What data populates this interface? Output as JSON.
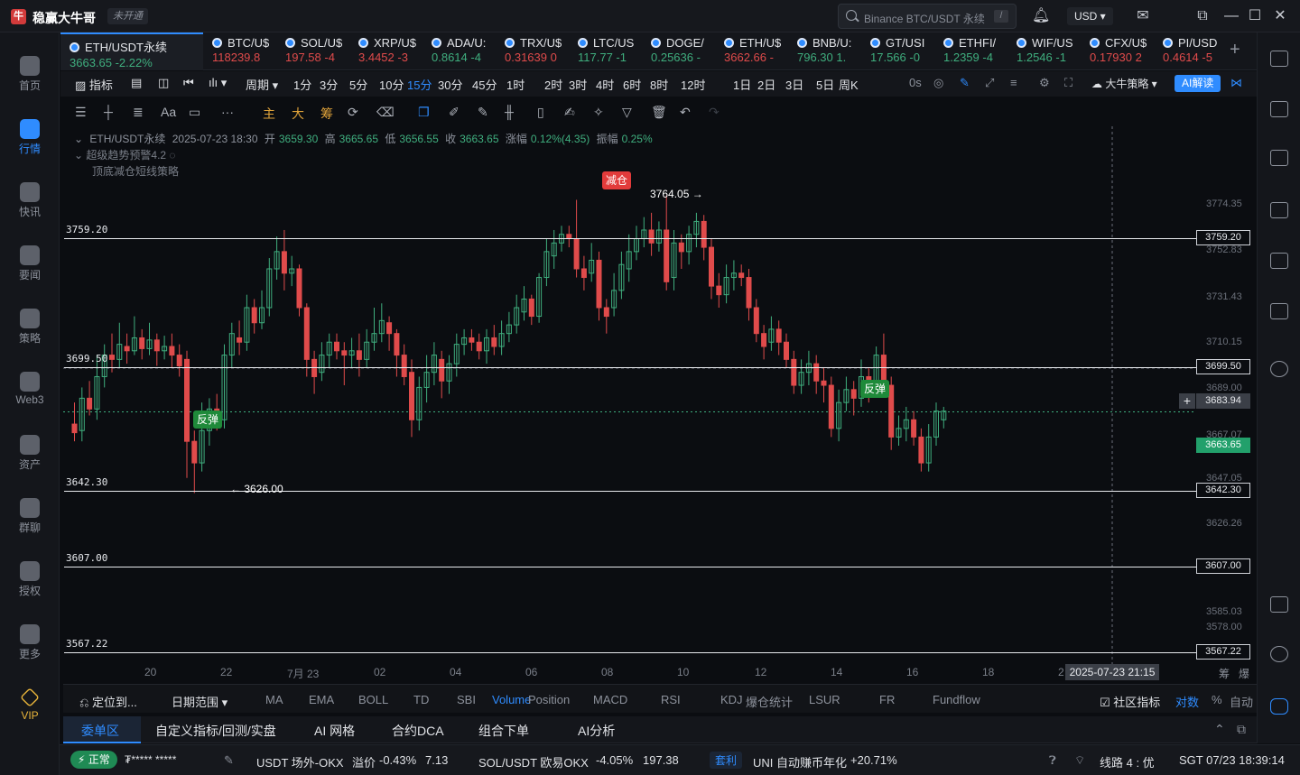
{
  "app": {
    "title": "稳赢大牛哥",
    "logo_text": "牛",
    "account_status": "未开通",
    "search_placeholder": "Binance BTC/USDT 永续",
    "search_shortcut": "/",
    "currency": "USD ▾"
  },
  "leftnav": [
    {
      "label": "首页",
      "active": false
    },
    {
      "label": "行情",
      "active": true
    },
    {
      "label": "快讯",
      "active": false
    },
    {
      "label": "要闻",
      "active": false
    },
    {
      "label": "策略",
      "active": false
    },
    {
      "label": "Web3",
      "active": false
    },
    {
      "label": "资产",
      "active": false
    },
    {
      "label": "群聊",
      "active": false
    },
    {
      "label": "授权",
      "active": false
    },
    {
      "label": "更多",
      "active": false
    },
    {
      "label": "VIP",
      "active": false
    }
  ],
  "tabs": [
    {
      "name": "ETH/USDT永续",
      "price": "3663.65 -2.22%",
      "dir": "up"
    },
    {
      "name": "BTC/U$",
      "price": "118239.8",
      "dir": "dn"
    },
    {
      "name": "SOL/U$",
      "price": "197.58 -4",
      "dir": "dn"
    },
    {
      "name": "XRP/U$",
      "price": "3.4452 -3",
      "dir": "dn"
    },
    {
      "name": "ADA/U:",
      "price": "0.8614 -4",
      "dir": "up"
    },
    {
      "name": "TRX/U$",
      "price": "0.31639 0",
      "dir": "dn"
    },
    {
      "name": "LTC/US",
      "price": "117.77 -1",
      "dir": "up"
    },
    {
      "name": "DOGE/",
      "price": "0.25636 -",
      "dir": "up"
    },
    {
      "name": "ETH/U$",
      "price": "3662.66 -",
      "dir": "dn"
    },
    {
      "name": "BNB/U:",
      "price": "796.30 1.",
      "dir": "up"
    },
    {
      "name": "GT/USI",
      "price": "17.566 -0",
      "dir": "up"
    },
    {
      "name": "ETHFI/",
      "price": "1.2359 -4",
      "dir": "up"
    },
    {
      "name": "WIF/US",
      "price": "1.2546 -1",
      "dir": "up"
    },
    {
      "name": "CFX/U$",
      "price": "0.17930 2",
      "dir": "dn"
    },
    {
      "name": "PI/USD",
      "price": "0.4614 -5",
      "dir": "dn"
    }
  ],
  "periodbar": {
    "indicator": "指标",
    "cycle": "周期 ▾",
    "periods": [
      "1分",
      "3分",
      "5分",
      "10分",
      "15分",
      "30分",
      "45分",
      "1时",
      "2时",
      "3时",
      "4时",
      "6时",
      "8时",
      "12时",
      "1日",
      "2日",
      "3日",
      "5日",
      "周K"
    ],
    "selected": "15分",
    "countdown": "0s",
    "strategy": "大牛策略 ▾",
    "ai": "AI解读"
  },
  "drawbar": {
    "main": "主",
    "big": "大",
    "chip": "筹",
    "font": "Aa"
  },
  "info": {
    "symbol": "ETH/USDT永续",
    "datetime": "2025-07-23 18:30",
    "open_label": "开",
    "open": "3659.30",
    "high_label": "高",
    "high": "3665.65",
    "low_label": "低",
    "low": "3656.55",
    "close_label": "收",
    "close": "3663.65",
    "chg_label": "涨幅",
    "chg": "0.12%(4.35)",
    "amp_label": "振幅",
    "amp": "0.25%",
    "ind1": "超级趋势预警4.2",
    "ind2": "顶底减仓短线策略"
  },
  "levels": [
    {
      "label": "3759.20",
      "box": "3759.20"
    },
    {
      "label": "3699.50",
      "box": "3699.50"
    },
    {
      "label": "3642.30",
      "box": "3642.30"
    },
    {
      "label": "3607.00",
      "box": "3607.00"
    },
    {
      "label": "3567.22",
      "box": "3567.22"
    }
  ],
  "price_ticks": [
    "3774.35",
    "3752.83",
    "3731.43",
    "3710.15",
    "3689.00",
    "3667.07",
    "3647.05",
    "3626.26",
    "3585.03",
    "3578.00"
  ],
  "last_price": "3663.65",
  "cross_price": "3683.94",
  "time_ticks": [
    "20",
    "22",
    "7月 23",
    "02",
    "04",
    "06",
    "08",
    "10",
    "12",
    "14",
    "16",
    "18",
    "2"
  ],
  "time_cross": "2025-07-23 21:15",
  "annotations": {
    "reduce": "减仓",
    "rebound1": "反弹",
    "rebound2": "反弹",
    "high_mark": "3764.05 →",
    "low_mark": "← 3626.00"
  },
  "indbar": {
    "locate": "定位到...",
    "date_range": "日期范围 ▾",
    "items": [
      "MA",
      "EMA",
      "BOLL",
      "TD",
      "SBI",
      "Volume",
      "Position",
      "MACD",
      "RSI",
      "KDJ",
      "爆仓统计",
      "LSUR",
      "FR",
      "Fundflow"
    ],
    "selected": "Volume",
    "community": "社区指标",
    "compare": "对数",
    "pct": "%",
    "auto": "自动",
    "corner1": "筹",
    "corner2": "爆"
  },
  "ordertabs": [
    "委单区",
    "自定义指标/回测/实盘",
    "AI 网格",
    "合约DCA",
    "组合下单",
    "AI分析"
  ],
  "statusbar": {
    "status": "正常",
    "user": "₮***** *****",
    "ticker1": "USDT 场外-OKX",
    "prem_label": "溢价",
    "prem": "-0.43%",
    "prem_val": "7.13",
    "ticker2": "SOL/USDT 欧易OKX",
    "t2chg": "-4.05%",
    "t2price": "197.38",
    "arb": "套利",
    "ticker3": "UNI 自动赚币年化",
    "t3val": "+20.71%",
    "line": "线路 4 : 优",
    "clock": "SGT 07/23 18:39:14"
  },
  "colors": {
    "up": "#3fae7e",
    "down": "#e04b4b",
    "accent": "#2f8cff"
  }
}
